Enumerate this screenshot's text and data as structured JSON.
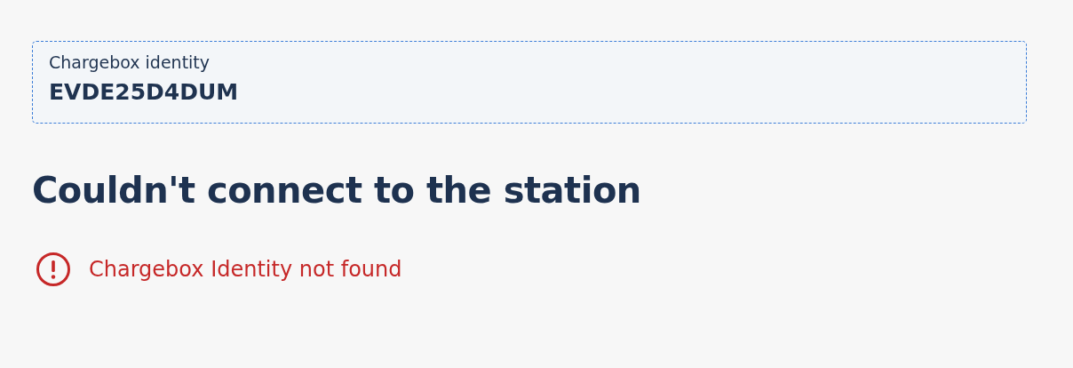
{
  "field": {
    "label": "Chargebox identity",
    "value": "EVDE25D4DUM"
  },
  "heading": "Couldn't connect to the station",
  "error": {
    "message": "Chargebox Identity not found"
  }
}
